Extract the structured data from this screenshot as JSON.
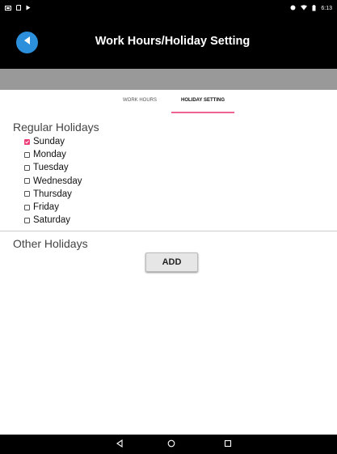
{
  "status_bar": {
    "time": "6:13"
  },
  "app_bar": {
    "title": "Work Hours/Holiday Setting",
    "accent_color": "#2b8fdc"
  },
  "tabs": [
    {
      "label": "WORK HOURS",
      "selected": false
    },
    {
      "label": "HOLIDAY SETTING",
      "selected": true
    }
  ],
  "regular_holidays": {
    "heading": "Regular Holidays",
    "days": [
      {
        "label": "Sunday",
        "checked": true
      },
      {
        "label": "Monday",
        "checked": false
      },
      {
        "label": "Tuesday",
        "checked": false
      },
      {
        "label": "Wednesday",
        "checked": false
      },
      {
        "label": "Thursday",
        "checked": false
      },
      {
        "label": "Friday",
        "checked": false
      },
      {
        "label": "Saturday",
        "checked": false
      }
    ]
  },
  "other_holidays": {
    "heading": "Other Holidays",
    "add_label": "ADD"
  },
  "colors": {
    "tab_indicator": "#f06292",
    "checkbox_checked": "#ec407a"
  },
  "icons": {
    "back": "back-arrow-icon",
    "nav_back": "nav-back-icon",
    "nav_home": "nav-home-icon",
    "nav_recent": "nav-recent-icon"
  }
}
